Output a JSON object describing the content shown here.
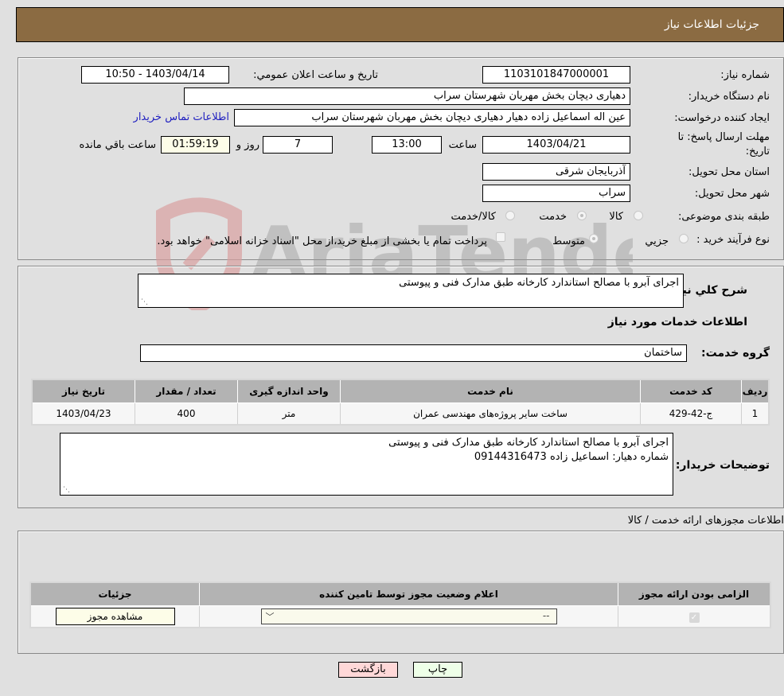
{
  "header": {
    "title": "جزئیات اطلاعات نیاز"
  },
  "form": {
    "need_number_label": "شماره نیاز:",
    "need_number": "1103101847000001",
    "announce_label": "تاریخ و ساعت اعلان عمومي:",
    "announce_value": "1403/04/14 - 10:50",
    "buyer_org_label": "نام دستگاه خریدار:",
    "buyer_org": "دهیاری دیچان  بخش مهربان شهرستان سراب",
    "creator_label": "ایجاد کننده درخواست:",
    "creator": "عین اله اسماعیل زاده دهیار  دهیاری دیچان  بخش مهربان شهرستان سراب",
    "contact_link": "اطلاعات تماس خریدار",
    "deadline_label_line1": "مهلت ارسال پاسخ: تا",
    "deadline_label_line2": "تاریخ:",
    "deadline_date": "1403/04/21",
    "time_label": "ساعت",
    "deadline_time": "13:00",
    "days": "7",
    "days_label": "روز و",
    "remaining": "01:59:19",
    "remaining_label": "ساعت باقي مانده",
    "province_label": "استان محل تحویل:",
    "province": "آذربایجان شرقی",
    "city_label": "شهر محل تحویل:",
    "city": "سراب",
    "category_label": "طبقه بندی موضوعی:",
    "category_options": [
      "کالا",
      "خدمت",
      "کالا/خدمت"
    ],
    "category_selected": "خدمت",
    "process_label": "نوع فرآیند خرید :",
    "process_options": [
      "جزيي",
      "متوسط"
    ],
    "process_selected": "متوسط",
    "treasury_note": "پرداخت تمام یا بخشی از مبلغ خرید،از محل \"اسناد خزانه اسلامی\" خواهد بود."
  },
  "description": {
    "label": "شرح کلي نیاز:",
    "value": "اجرای آبرو با مصالح استاندارد کارخانه طبق مدارک فنی و پیوستی",
    "services_heading": "اطلاعات خدمات مورد نیاز",
    "group_label": "گروه خدمت:",
    "group_value": "ساختمان"
  },
  "services_table": {
    "headers": [
      "ردیف",
      "کد خدمت",
      "نام خدمت",
      "واحد اندازه گیری",
      "تعداد / مقدار",
      "تاریخ نیاز"
    ],
    "rows": [
      [
        "1",
        "ج-42-429",
        "ساخت سایر پروژه‌های مهندسی عمران",
        "متر",
        "400",
        "1403/04/23"
      ]
    ]
  },
  "buyer_notes": {
    "label": "توضیحات خریدار:",
    "line1": "اجرای آبرو با مصالح استاندارد کارخانه طبق مدارک فنی و پیوستی",
    "line2": "شماره دهیار: اسماعیل زاده 09144316473"
  },
  "permits": {
    "heading": "اطلاعات مجوزهای ارائه خدمت / کالا",
    "headers": [
      "الزامی بودن ارائه مجوز",
      "اعلام وضعیت مجوز توسط تامین کننده",
      "جزئیات"
    ],
    "select_value": "--",
    "view_button": "مشاهده مجوز"
  },
  "buttons": {
    "back": "بازگشت",
    "print": "چاپ"
  },
  "watermark": "AriaTender.neT",
  "colors": {
    "header_bg": "#8b6b42",
    "back_btn_bg": "#ffd8d8",
    "print_btn_bg": "#eeffe8",
    "link": "#2020c0"
  }
}
